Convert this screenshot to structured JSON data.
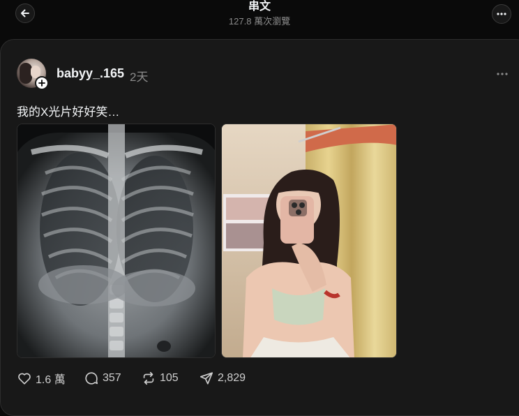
{
  "header": {
    "title": "串文",
    "views": "127.8 萬次瀏覽"
  },
  "post": {
    "username": "babyy_.165",
    "time": "2天",
    "text": "我的X光片好好笑…",
    "images": [
      {
        "subject": "chest X-ray"
      },
      {
        "subject": "mirror selfie"
      }
    ],
    "stats": {
      "likes": "1.6 萬",
      "replies": "357",
      "reposts": "105",
      "shares": "2,829"
    }
  },
  "icons": {
    "back": "arrow-left-icon",
    "more": "ellipsis-icon",
    "follow": "plus-icon",
    "like": "heart-icon",
    "reply": "comment-bubble-icon",
    "repost": "repost-icon",
    "share": "send-icon"
  },
  "colors": {
    "background": "#0a0a0a",
    "card": "#181818",
    "muted_text": "#8c8c8c"
  }
}
